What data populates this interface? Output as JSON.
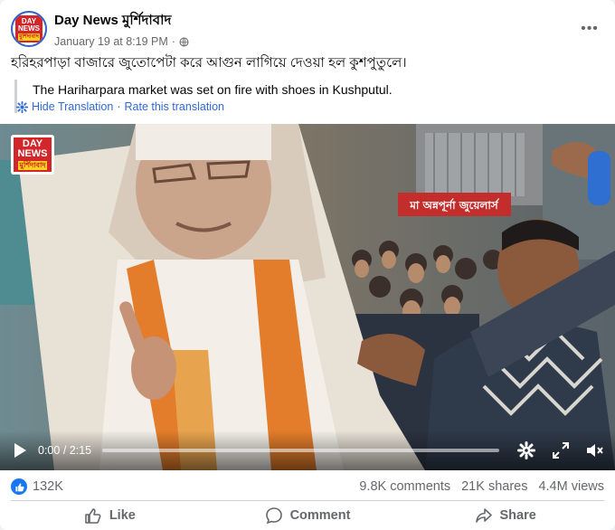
{
  "post": {
    "page_name": "Day News মুর্শিদাবাদ",
    "timestamp": "January 19 at 8:19 PM",
    "separator": "·",
    "text": "হরিহরপাড়া বাজারে জুতোপেটা করে আগুন লাগিয়ে দেওয়া হল কুশপুতুলে।",
    "translation": "The Hariharpara market was set on fire with shoes in Kushputul.",
    "hide_translation": "Hide Translation",
    "link_separator": "·",
    "rate_translation": "Rate this translation",
    "more_label": "•••"
  },
  "logo": {
    "line1": "DAY",
    "line2": "NEWS",
    "line3": "মুর্শিদাবাদ"
  },
  "video": {
    "current_time": "0:00",
    "time_separator": "/",
    "duration": "2:15",
    "progress": 0,
    "icons": [
      "play-icon",
      "settings-icon",
      "fullscreen-icon",
      "volume-muted-icon"
    ],
    "banner_text": "মা অন্নপূর্না জুয়েলার্স"
  },
  "stats": {
    "reactions": "132K",
    "comments": "9.8K comments",
    "shares": "21K shares",
    "views": "4.4M views"
  },
  "actions": {
    "like": "Like",
    "comment": "Comment",
    "share": "Share"
  },
  "colors": {
    "accent": "#1877f2",
    "link": "#2f6ad6",
    "muted": "#65676b",
    "logo_red": "#d1272b",
    "logo_yellow": "#ffd21f"
  }
}
